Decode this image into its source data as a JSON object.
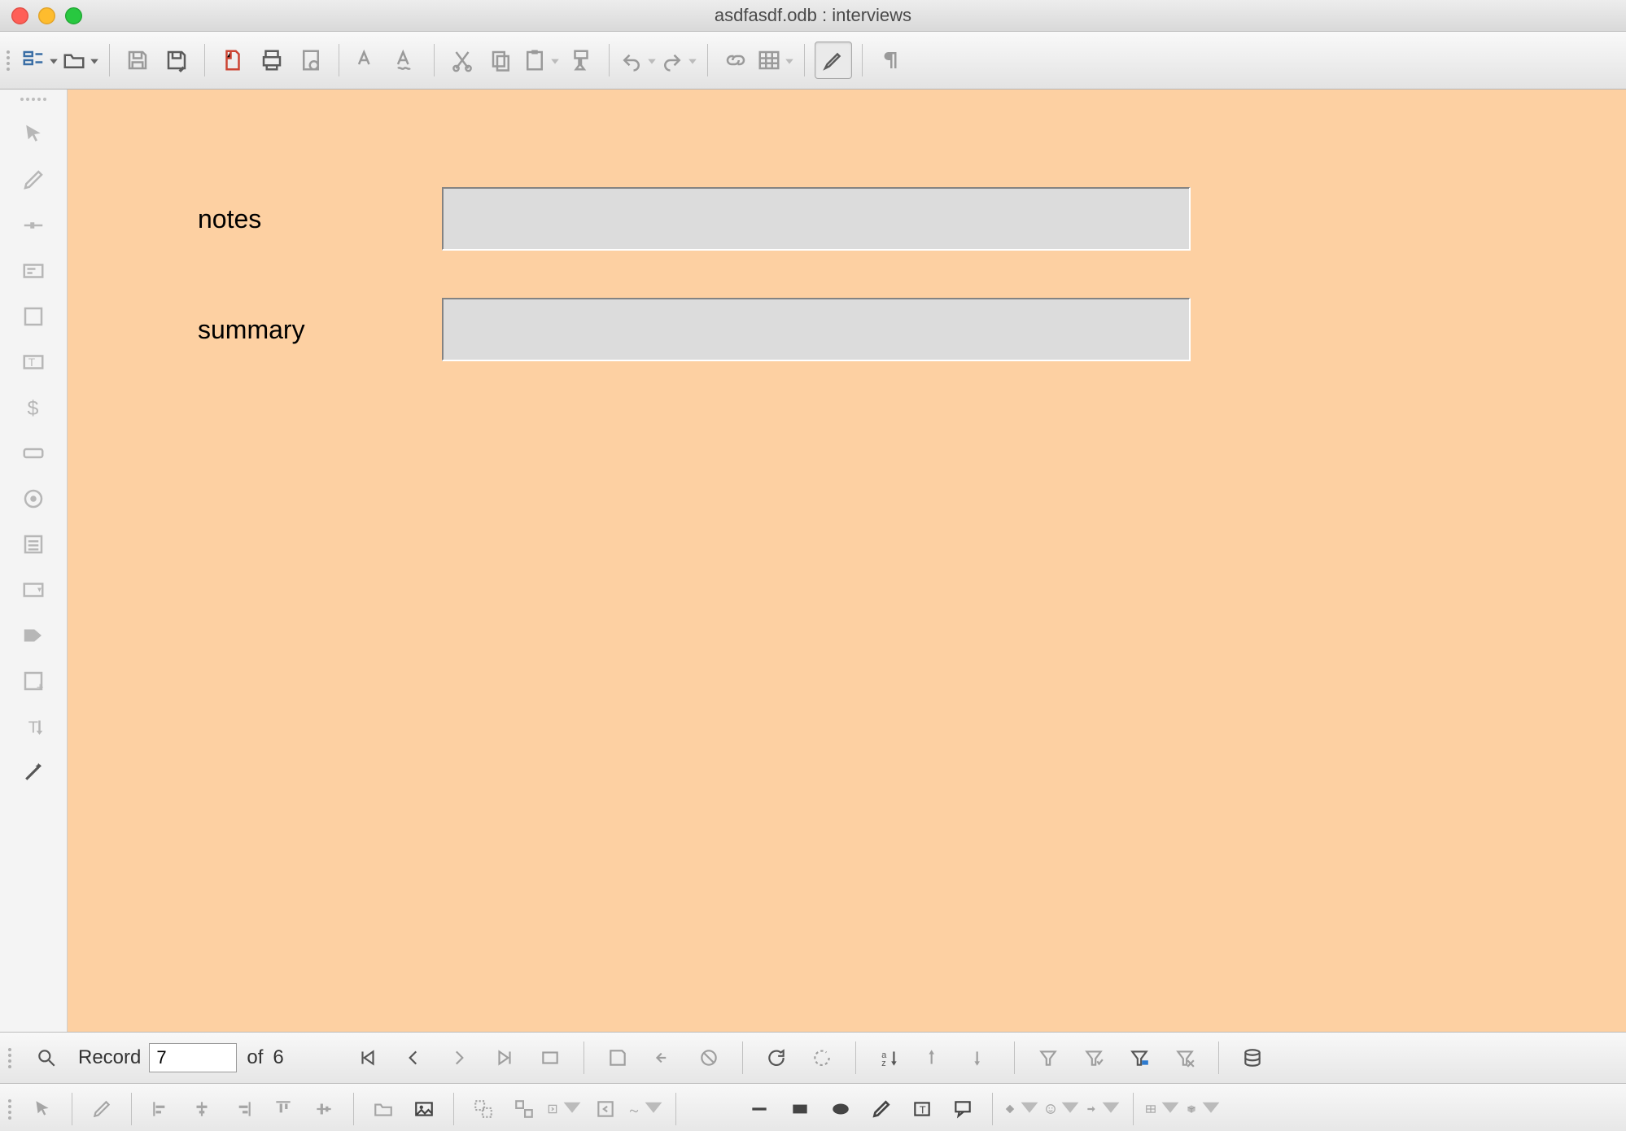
{
  "window": {
    "title": "asdfasdf.odb : interviews"
  },
  "toolbar": {
    "items": [
      {
        "name": "form-design",
        "iconColor": "#2e7bcf"
      },
      {
        "name": "open",
        "iconColor": "#5b5b5b"
      },
      {
        "name": "save",
        "iconColor": "#9a9a9a"
      },
      {
        "name": "save-as",
        "iconColor": "#5b5b5b"
      },
      {
        "name": "export-pdf",
        "iconColor": "#c43"
      },
      {
        "name": "print",
        "iconColor": "#5b5b5b"
      },
      {
        "name": "print-preview",
        "iconColor": "#9a9a9a"
      },
      {
        "name": "spellcheck",
        "iconColor": "#9a9a9a"
      },
      {
        "name": "auto-spellcheck",
        "iconColor": "#9a9a9a"
      },
      {
        "name": "cut",
        "iconColor": "#9a9a9a"
      },
      {
        "name": "copy",
        "iconColor": "#9a9a9a"
      },
      {
        "name": "paste",
        "iconColor": "#9a9a9a"
      },
      {
        "name": "clone-formatting",
        "iconColor": "#9a9a9a"
      },
      {
        "name": "undo",
        "iconColor": "#9a9a9a"
      },
      {
        "name": "redo",
        "iconColor": "#9a9a9a"
      },
      {
        "name": "hyperlink",
        "iconColor": "#9a9a9a"
      },
      {
        "name": "table",
        "iconColor": "#9a9a9a"
      },
      {
        "name": "highlighting",
        "iconColor": "#5b5b5b"
      },
      {
        "name": "formatting-marks",
        "iconColor": "#9a9a9a"
      }
    ]
  },
  "sidepanel": {
    "items": [
      "select",
      "edit",
      "line",
      "label-field",
      "checkbox",
      "text-box",
      "currency-field",
      "push-button",
      "option-button",
      "list-box",
      "combo-box",
      "image-control",
      "more-controls",
      "wizard"
    ],
    "enabled": {
      "wizard": true
    }
  },
  "form": {
    "fields": [
      {
        "label": "notes",
        "value": ""
      },
      {
        "label": "summary",
        "value": ""
      }
    ]
  },
  "recordbar": {
    "searchIcon": "search",
    "label": "Record",
    "current": "7",
    "ofLabel": "of",
    "total": "6",
    "nav": [
      "first",
      "prev",
      "next",
      "last",
      "new",
      "save",
      "undo",
      "delete",
      "refresh",
      "refresh-control",
      "sort",
      "autofilter",
      "apply-filter",
      "form-based-filter",
      "remove-filter",
      "data-source"
    ],
    "navEnabled": {
      "first": true,
      "prev": true,
      "refresh": true,
      "sort": true,
      "form-based-filter": true,
      "data-source": true
    }
  },
  "drawbar": {
    "items": [
      "select",
      "edit",
      "align-left",
      "align-center",
      "align-right",
      "align-top",
      "align-middle",
      "align-bottom",
      "open-folder",
      "insert-image",
      "group",
      "ungroup",
      "enter-group",
      "exit-group",
      "freeform",
      "line",
      "rect",
      "ellipse",
      "pencil",
      "text",
      "callout",
      "basic-shapes",
      "symbol-shapes",
      "arrow-shapes",
      "table",
      "3d"
    ],
    "enabled": {
      "insert-image": true,
      "line": true,
      "rect": true,
      "ellipse": true,
      "pencil": true,
      "text": true,
      "callout": true
    }
  }
}
